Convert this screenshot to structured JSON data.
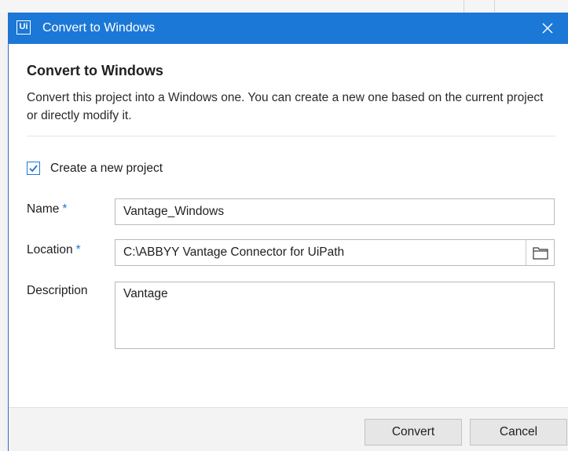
{
  "window": {
    "title": "Convert to Windows",
    "logo_text": "Ui",
    "accent_color": "#1c78d6",
    "close_icon": "close-icon"
  },
  "dialog": {
    "heading": "Convert to Windows",
    "description": "Convert this project into a Windows one. You can create a new one based on the current project or directly modify it."
  },
  "form": {
    "create_new": {
      "label": "Create a new project",
      "checked": true
    },
    "name": {
      "label": "Name",
      "required_marker": "*",
      "value": "Vantage_Windows"
    },
    "location": {
      "label": "Location",
      "required_marker": "*",
      "value": "C:\\ABBYY Vantage Connector for UiPath",
      "browse_icon": "folder-icon"
    },
    "description": {
      "label": "Description",
      "value": "Vantage"
    }
  },
  "footer": {
    "convert_label": "Convert",
    "cancel_label": "Cancel"
  }
}
